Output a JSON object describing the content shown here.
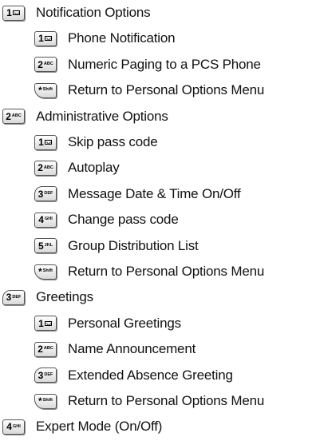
{
  "menu": [
    {
      "level": 0,
      "key": {
        "num": "1",
        "sub": "",
        "glyph": "envelope"
      },
      "label": "Notification Options"
    },
    {
      "level": 1,
      "key": {
        "num": "1",
        "sub": "",
        "glyph": "envelope"
      },
      "label": "Phone Notification"
    },
    {
      "level": 1,
      "key": {
        "num": "2",
        "sub": "ABC",
        "glyph": ""
      },
      "label": "Numeric Paging to a PCS Phone"
    },
    {
      "level": 1,
      "key": {
        "num": "*",
        "sub": "Shift",
        "glyph": ""
      },
      "label": "Return to Personal Options Menu"
    },
    {
      "level": 0,
      "key": {
        "num": "2",
        "sub": "ABC",
        "glyph": ""
      },
      "label": "Administrative Options"
    },
    {
      "level": 1,
      "key": {
        "num": "1",
        "sub": "",
        "glyph": "envelope"
      },
      "label": "Skip pass code"
    },
    {
      "level": 1,
      "key": {
        "num": "2",
        "sub": "ABC",
        "glyph": ""
      },
      "label": "Autoplay"
    },
    {
      "level": 1,
      "key": {
        "num": "3",
        "sub": "DEF",
        "glyph": ""
      },
      "label": "Message Date & Time On/Off"
    },
    {
      "level": 1,
      "key": {
        "num": "4",
        "sub": "GHI",
        "glyph": ""
      },
      "label": "Change pass code"
    },
    {
      "level": 1,
      "key": {
        "num": "5",
        "sub": "JKL",
        "glyph": ""
      },
      "label": "Group Distribution List"
    },
    {
      "level": 1,
      "key": {
        "num": "*",
        "sub": "Shift",
        "glyph": ""
      },
      "label": "Return to Personal Options Menu"
    },
    {
      "level": 0,
      "key": {
        "num": "3",
        "sub": "DEF",
        "glyph": ""
      },
      "label": "Greetings"
    },
    {
      "level": 1,
      "key": {
        "num": "1",
        "sub": "",
        "glyph": "envelope"
      },
      "label": "Personal Greetings"
    },
    {
      "level": 1,
      "key": {
        "num": "2",
        "sub": "ABC",
        "glyph": ""
      },
      "label": "Name Announcement"
    },
    {
      "level": 1,
      "key": {
        "num": "3",
        "sub": "DEF",
        "glyph": ""
      },
      "label": "Extended Absence Greeting"
    },
    {
      "level": 1,
      "key": {
        "num": "*",
        "sub": "Shift",
        "glyph": ""
      },
      "label": "Return to Personal Options Menu"
    },
    {
      "level": 0,
      "key": {
        "num": "4",
        "sub": "GHI",
        "glyph": ""
      },
      "label": "Expert Mode (On/Off)"
    }
  ]
}
